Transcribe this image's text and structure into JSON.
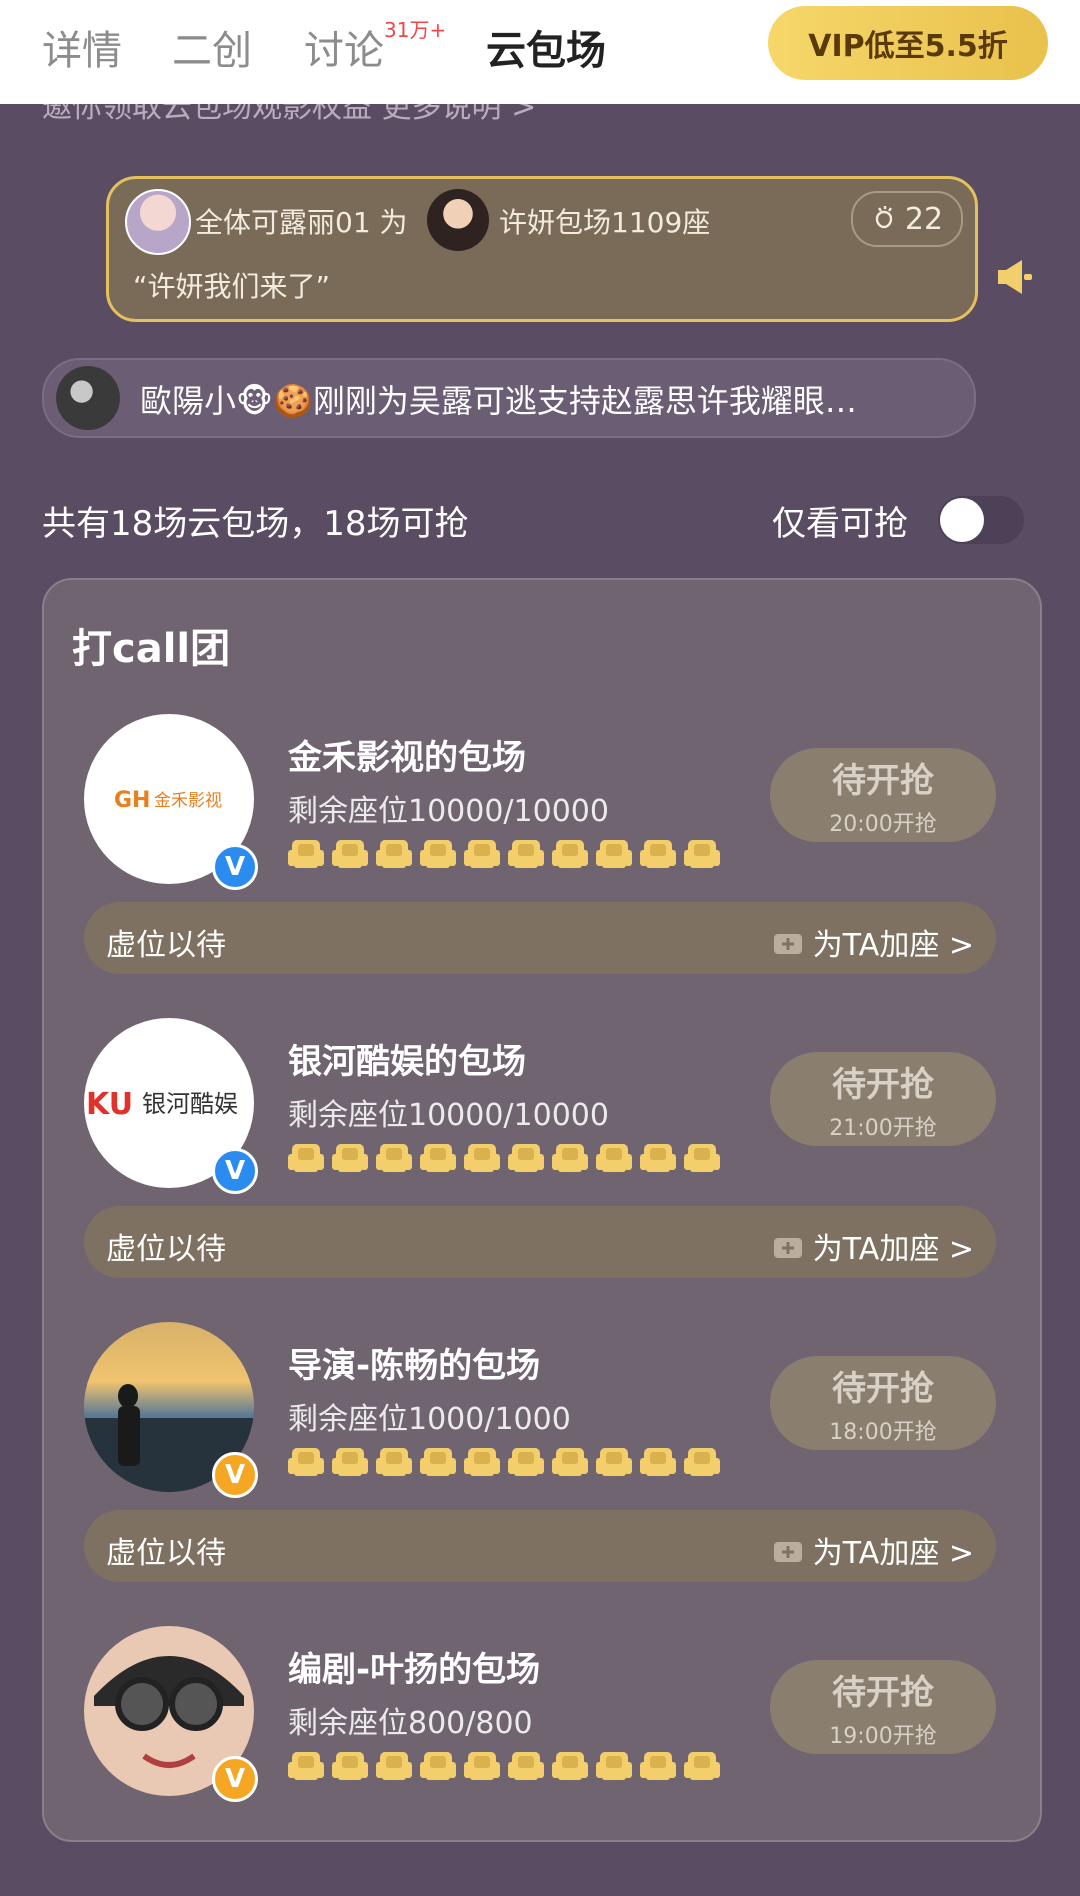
{
  "header": {
    "tabs": [
      {
        "label": "详情"
      },
      {
        "label": "二创"
      },
      {
        "label": "讨论"
      },
      {
        "label": "云包场"
      }
    ],
    "discuss_badge": "31万+",
    "vip_button": "VIP低至5.5折"
  },
  "banner_faded": "邀你领取云包场观影权益 更多说明 >",
  "cheer": {
    "user": "全体可露丽01 为",
    "target": "许妍包场1109座",
    "message": "“许妍我们来了”",
    "clap_count": "22"
  },
  "ticker": {
    "text": "歐陽小🐵🍪刚刚为吴露可逃支持赵露思许我耀眼…"
  },
  "summary": {
    "count_text": "共有18场云包场，18场可抢",
    "filter_label": "仅看可抢"
  },
  "panel": {
    "title": "打call团"
  },
  "items": [
    {
      "name": "金禾影视的包场",
      "seats": "剩余座位10000/10000",
      "grab_label": "待开抢",
      "grab_time": "20:00开抢",
      "wait_label": "虚位以待",
      "add_label": "为TA加座 >",
      "logo_text": "金禾影视",
      "badge_color": "#2b8cf0"
    },
    {
      "name": "银河酷娱的包场",
      "seats": "剩余座位10000/10000",
      "grab_label": "待开抢",
      "grab_time": "21:00开抢",
      "wait_label": "虚位以待",
      "add_label": "为TA加座 >",
      "logo_text": "银河酷娱",
      "badge_color": "#2b8cf0"
    },
    {
      "name": "导演-陈畅的包场",
      "seats": "剩余座位1000/1000",
      "grab_label": "待开抢",
      "grab_time": "18:00开抢",
      "wait_label": "虚位以待",
      "add_label": "为TA加座 >",
      "logo_text": "",
      "badge_color": "#f5a623"
    },
    {
      "name": "编剧-叶扬的包场",
      "seats": "剩余座位800/800",
      "grab_label": "待开抢",
      "grab_time": "19:00开抢",
      "wait_label": "",
      "add_label": "",
      "logo_text": "",
      "badge_color": "#f5a623"
    }
  ],
  "colors": {
    "accent_gold": "#e6c05f",
    "seat_gold": "#f2cf6a",
    "background": "#5a4d63"
  }
}
